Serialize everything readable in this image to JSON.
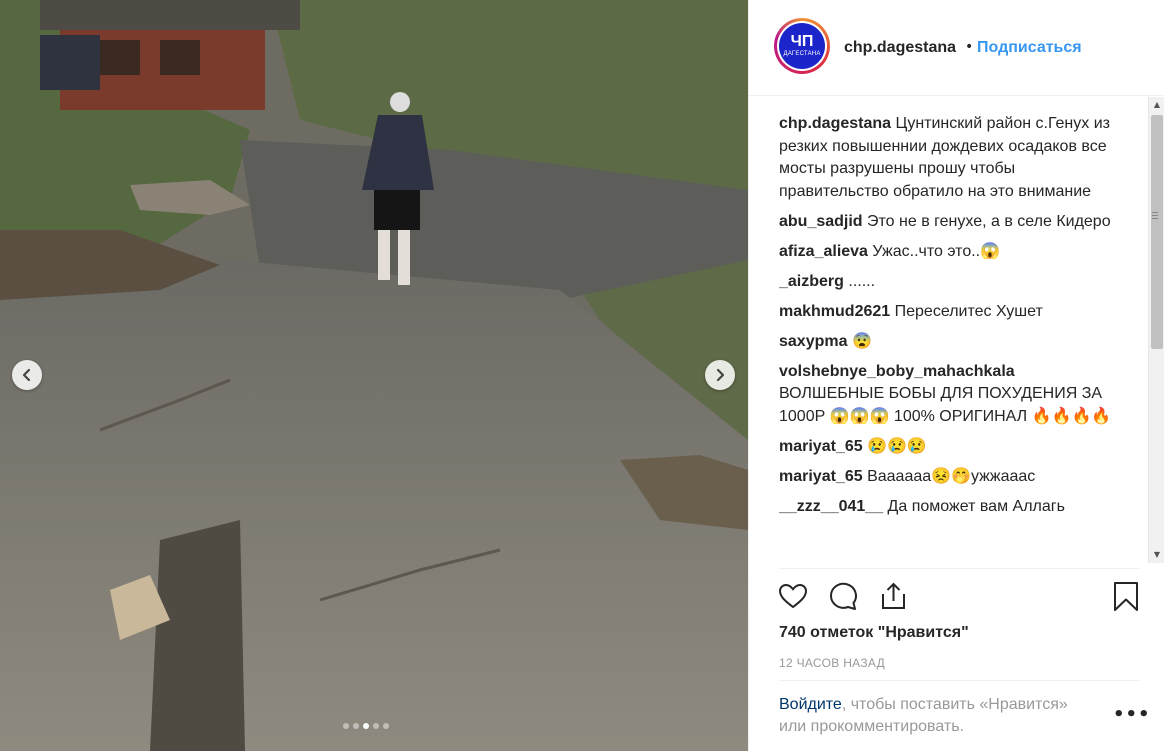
{
  "media": {
    "dots_count": 5,
    "active_dot": 3
  },
  "header": {
    "avatar_big": "ЧП",
    "avatar_small": "ДАГЕСТАНА",
    "username": "chp.dagestana",
    "separator": "•",
    "follow": "Подписаться"
  },
  "comments": [
    {
      "user": "chp.dagestana",
      "text": "Цунтинский район с.Генух из резких повышеннии дождевих осадаков все мосты разрушены прошу чтобы правительство обратило на это внимание"
    },
    {
      "user": "abu_sadjid",
      "text": "Это не в генухе, а в селе Кидеро"
    },
    {
      "user": "afiza_alieva",
      "text": "Ужас..что это..😱"
    },
    {
      "user": "_aizberg",
      "text": "......"
    },
    {
      "user": "makhmud2621",
      "text": "Переселитес Хушет"
    },
    {
      "user": "saxypma",
      "text": "😨"
    },
    {
      "user": "volshebnye_boby_mahachkala",
      "text": "ВОЛШЕБНЫЕ БОБЫ ДЛЯ ПОХУДЕНИЯ ЗА 1000Р 😱😱😱 100% ОРИГИНАЛ 🔥🔥🔥🔥"
    },
    {
      "user": "mariyat_65",
      "text": "😢😢😢"
    },
    {
      "user": "mariyat_65",
      "text": "Ваааааа😣🤭ужжааас"
    },
    {
      "user": "__zzz__041__",
      "text": "Да поможет вам Аллагь"
    }
  ],
  "actions": {
    "like_icon": "heart-icon",
    "comment_icon": "speech-bubble-icon",
    "share_icon": "share-icon",
    "save_icon": "bookmark-icon"
  },
  "likes": "740 отметок \"Нравится\"",
  "time": "12 часов назад",
  "login_prompt": {
    "link": "Войдите",
    "text": ", чтобы поставить «Нравится» или прокомментировать."
  },
  "more": "•••",
  "colors": {
    "link_blue": "#3897f0",
    "text": "#262626",
    "muted": "#999999",
    "avatar_blue": "#1c25c9"
  }
}
